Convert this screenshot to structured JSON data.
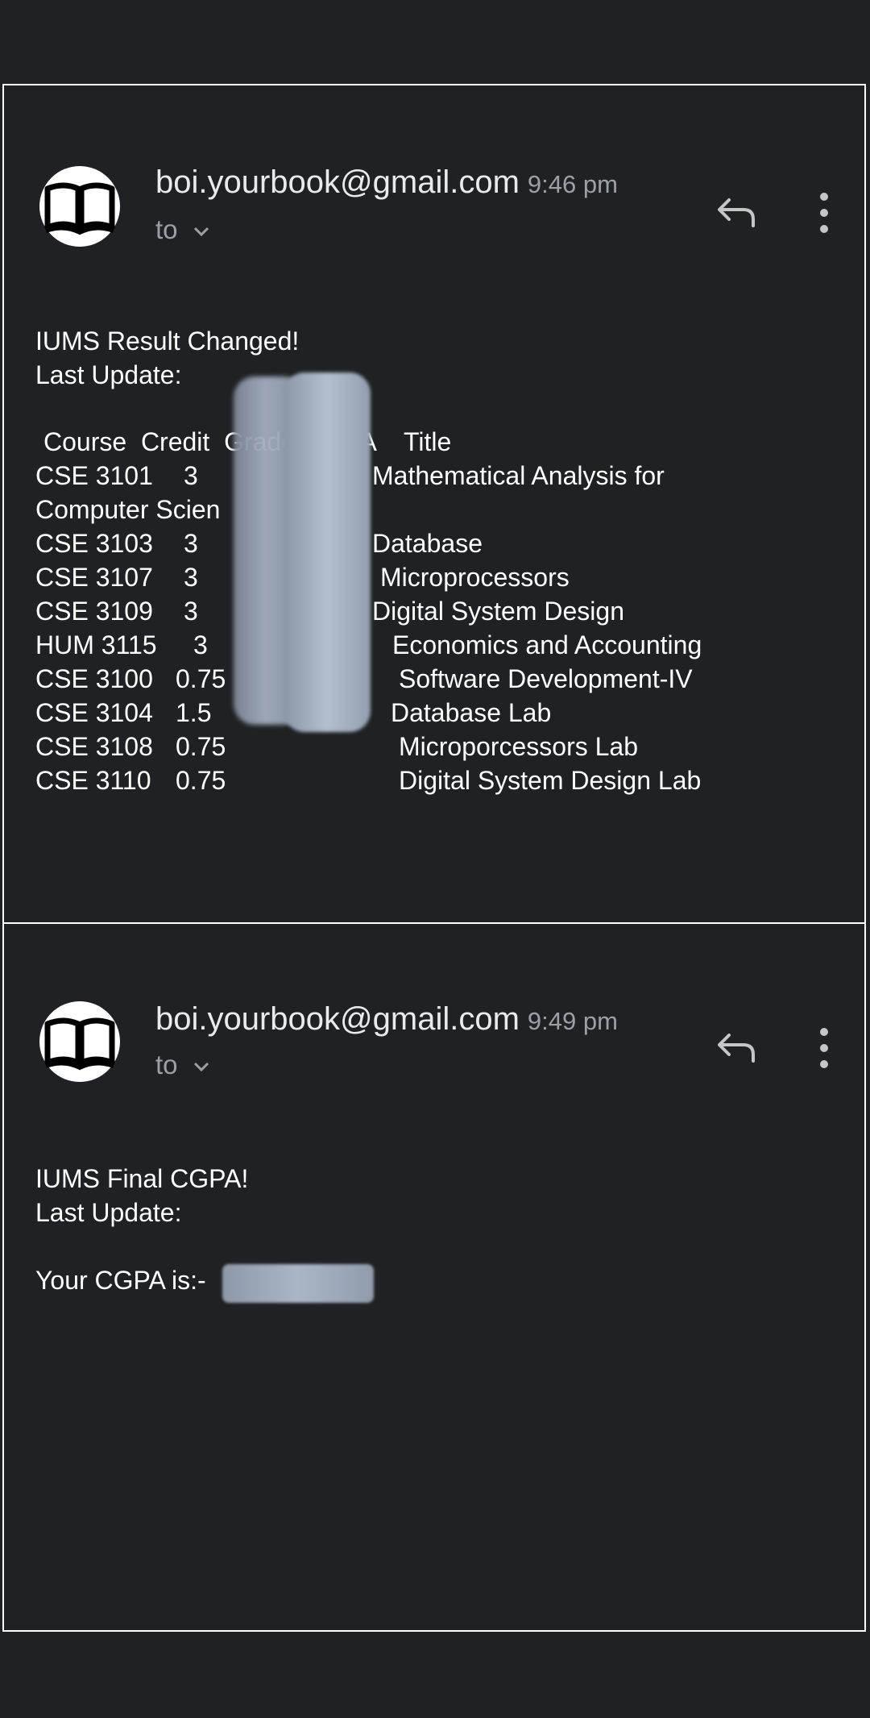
{
  "emails": [
    {
      "sender": "boi.yourbook@gmail.com",
      "time": "9:46 pm",
      "to_label": "to",
      "subject_line": "IUMS Result Changed!",
      "last_update": "Last Update:",
      "table_header": "Course  Credit  Grade    GPA    Title",
      "rows": [
        {
          "course": "CSE 3101",
          "credit": "3",
          "title": "Mathematical Analysis for"
        },
        {
          "course": "CSE 3103",
          "credit": "3",
          "title": "Database"
        },
        {
          "course": "CSE 3107",
          "credit": "3",
          "title": "Microprocessors"
        },
        {
          "course": "CSE 3109",
          "credit": "3",
          "title": "Digital System Design"
        },
        {
          "course": "HUM 3115",
          "credit": "3",
          "title": "Economics and Accounting"
        },
        {
          "course": "CSE 3100",
          "credit": "0.75",
          "title": "Software Development-IV"
        },
        {
          "course": "CSE 3104",
          "credit": "1.5",
          "title": "Database Lab"
        },
        {
          "course": "CSE 3108",
          "credit": "0.75",
          "title": "Microporcessors Lab"
        },
        {
          "course": "CSE 3110",
          "credit": "0.75",
          "title": "Digital System Design Lab"
        }
      ],
      "title_wrap": "Computer Scien"
    },
    {
      "sender": "boi.yourbook@gmail.com",
      "time": "9:49 pm",
      "to_label": "to",
      "subject_line": "IUMS Final CGPA!",
      "last_update": "Last Update:",
      "cgpa_label": "Your CGPA is:-"
    }
  ],
  "icons": {
    "avatar": "open-book-icon",
    "reply": "reply-icon",
    "more": "more-vertical-icon",
    "expand": "chevron-down-icon"
  }
}
